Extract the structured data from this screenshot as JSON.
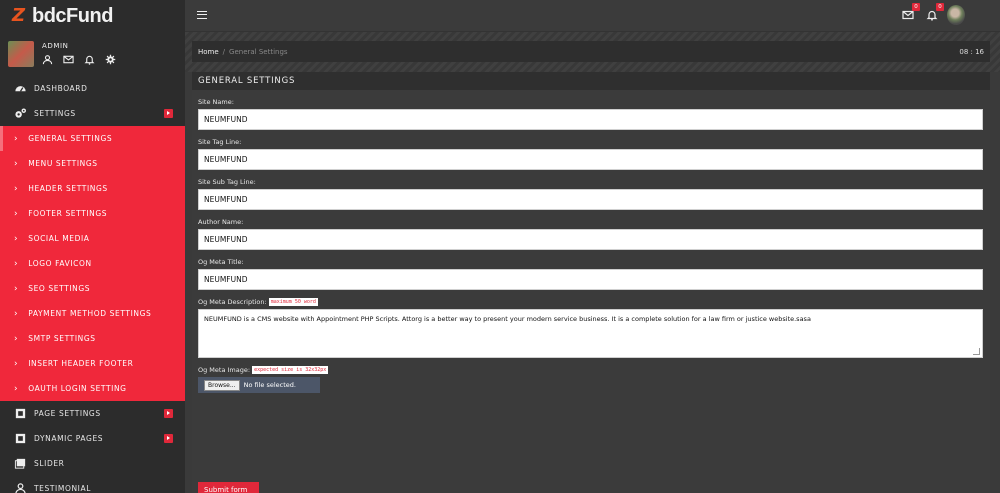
{
  "brand": {
    "logo_text": "bdcFund"
  },
  "user": {
    "name": "ADMIN"
  },
  "sidebar": {
    "items_top": [
      {
        "label": "DASHBOARD",
        "icon": "dashboard-icon"
      },
      {
        "label": "SETTINGS",
        "icon": "gears-icon"
      }
    ],
    "sub_items": [
      {
        "label": "GENERAL SETTINGS"
      },
      {
        "label": "MENU SETTINGS"
      },
      {
        "label": "HEADER SETTINGS"
      },
      {
        "label": "FOOTER SETTINGS"
      },
      {
        "label": "SOCIAL MEDIA"
      },
      {
        "label": "LOGO FAVICON"
      },
      {
        "label": "SEO SETTINGS"
      },
      {
        "label": "PAYMENT METHOD SETTINGS"
      },
      {
        "label": "SMTP SETTINGS"
      },
      {
        "label": "INSERT HEADER FOOTER"
      },
      {
        "label": "OAUTH LOGIN SETTING"
      }
    ],
    "items_bottom": [
      {
        "label": "PAGE SETTINGS",
        "icon": "expand-icon"
      },
      {
        "label": "DYNAMIC PAGES",
        "icon": "expand-icon"
      },
      {
        "label": "SLIDER",
        "icon": "images-icon"
      },
      {
        "label": "TESTIMONIAL",
        "icon": "user-icon"
      }
    ]
  },
  "topbar": {
    "mail_count": "0",
    "bell_count": "0"
  },
  "breadcrumb": {
    "home": "Home",
    "separator": "/",
    "current": "General Settings",
    "time": "08 : 16"
  },
  "panel": {
    "title": "GENERAL SETTINGS"
  },
  "form": {
    "site_name": {
      "label": "Site Name:",
      "value": "NEUMFUND"
    },
    "site_tag_line": {
      "label": "Site Tag Line:",
      "value": "NEUMFUND"
    },
    "site_sub_tag_line": {
      "label": "Site Sub Tag Line:",
      "value": "NEUMFUND"
    },
    "author_name": {
      "label": "Author Name:",
      "value": "NEUMFUND"
    },
    "og_meta_title": {
      "label": "Og Meta Title:",
      "value": "NEUMFUND"
    },
    "og_meta_description": {
      "label": "Og Meta Description:",
      "hint": "maximum 50 word",
      "value": "NEUMFUND is a CMS website with Appointment PHP Scripts. Attorg is a better way to present your modern service business. It is a complete solution for a law firm or justice website.sasa"
    },
    "og_meta_image": {
      "label": "Og Meta Image:",
      "hint": "expected size is 32x32px",
      "browse_label": "Browse...",
      "file_status": "No file selected."
    },
    "submit_label": "Submit form"
  }
}
